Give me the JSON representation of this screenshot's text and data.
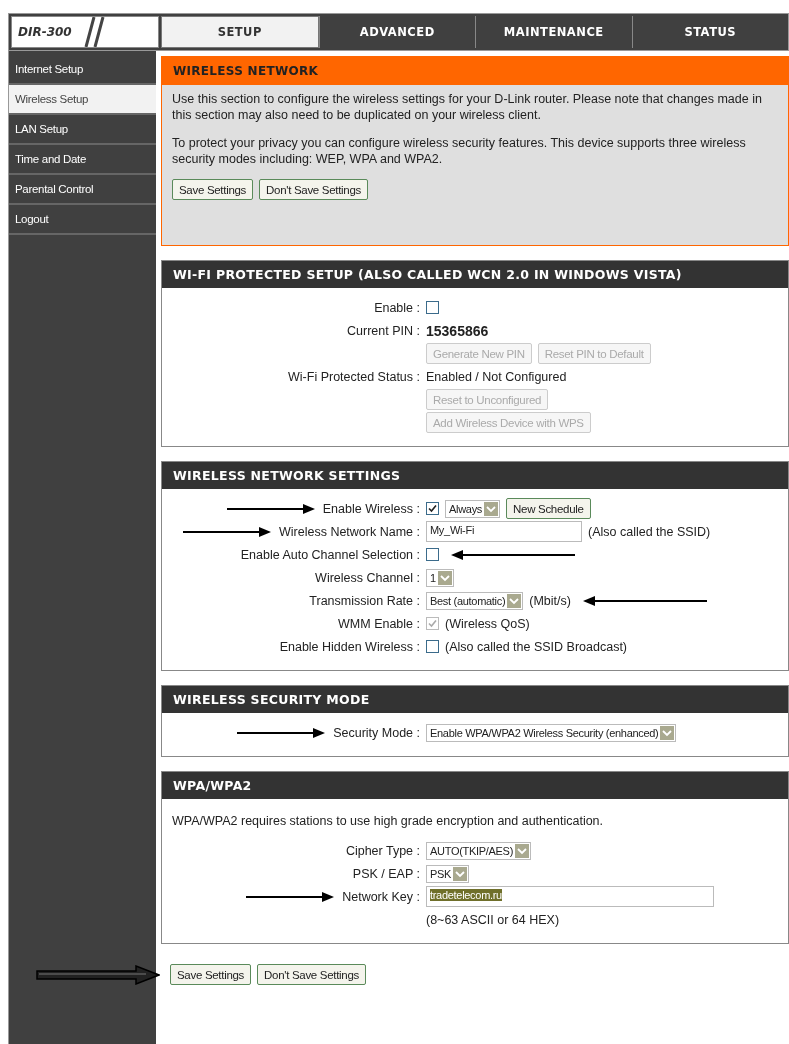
{
  "model": "DIR-300",
  "tabs": [
    {
      "label": "SETUP",
      "selected": true
    },
    {
      "label": "ADVANCED",
      "selected": false
    },
    {
      "label": "MAINTENANCE",
      "selected": false
    },
    {
      "label": "STATUS",
      "selected": false
    }
  ],
  "sidebar": {
    "items": [
      {
        "label": "Internet Setup",
        "selected": false
      },
      {
        "label": "Wireless Setup",
        "selected": true
      },
      {
        "label": "LAN Setup",
        "selected": false
      },
      {
        "label": "Time and Date",
        "selected": false
      },
      {
        "label": "Parental Control",
        "selected": false
      },
      {
        "label": "Logout",
        "selected": false
      }
    ]
  },
  "sections": [
    {
      "kind": "intro",
      "title": "WIRELESS NETWORK",
      "paragraphs": [
        "Use this section to configure the wireless settings for your D-Link router. Please note that changes made in this section may also need to be duplicated on your wireless client.",
        "To protect your privacy you can configure wireless security features. This device supports three wireless security modes including: WEP, WPA and WPA2."
      ],
      "buttons": [
        {
          "label": "Save Settings",
          "disabled": false
        },
        {
          "label": "Don't Save Settings",
          "disabled": false
        }
      ]
    },
    {
      "kind": "panel",
      "title": "WI-FI PROTECTED SETUP (ALSO CALLED WCN 2.0 IN WINDOWS VISTA)",
      "rows": [
        {
          "label": "Enable :",
          "controls": [
            {
              "kind": "checkbox",
              "checked": false,
              "disabled": false
            }
          ]
        },
        {
          "label": "Current PIN :",
          "controls": [
            {
              "kind": "text",
              "text": "15365866",
              "bold": true
            }
          ]
        },
        {
          "controls": [
            {
              "kind": "button",
              "label": "Generate New PIN",
              "disabled": true
            },
            {
              "kind": "button",
              "label": "Reset PIN to Default",
              "disabled": true
            }
          ]
        },
        {
          "label": "Wi-Fi Protected Status :",
          "controls": [
            {
              "kind": "text",
              "text": "Enabled / Not Configured",
              "bold": false
            }
          ]
        },
        {
          "controls": [
            {
              "kind": "button",
              "label": "Reset to Unconfigured",
              "disabled": true
            }
          ]
        },
        {
          "controls": [
            {
              "kind": "button",
              "label": "Add Wireless Device with WPS",
              "disabled": true
            }
          ]
        }
      ]
    },
    {
      "kind": "panel",
      "title": "WIRELESS NETWORK SETTINGS",
      "rows": [
        {
          "label": "Enable Wireless :",
          "arrow_left": true,
          "controls": [
            {
              "kind": "checkbox",
              "checked": true,
              "disabled": false
            },
            {
              "kind": "select",
              "value": "Always"
            },
            {
              "kind": "button",
              "label": "New Schedule",
              "disabled": false
            }
          ]
        },
        {
          "label": "Wireless Network Name :",
          "arrow_left": true,
          "controls": [
            {
              "kind": "input",
              "value": "My_Wi-Fi",
              "highlighted": false
            },
            {
              "kind": "note",
              "text": "(Also called the SSID)"
            }
          ]
        },
        {
          "label": "Enable Auto Channel Selection :",
          "arrow_right": true,
          "controls": [
            {
              "kind": "checkbox",
              "checked": false,
              "disabled": false
            }
          ]
        },
        {
          "label": "Wireless Channel :",
          "controls": [
            {
              "kind": "select",
              "value": "1"
            }
          ]
        },
        {
          "label": "Transmission Rate :",
          "arrow_right": true,
          "controls": [
            {
              "kind": "select",
              "value": "Best (automatic)"
            },
            {
              "kind": "note",
              "text": "(Mbit/s)"
            }
          ]
        },
        {
          "label": "WMM Enable :",
          "controls": [
            {
              "kind": "checkbox",
              "checked": true,
              "disabled": true
            },
            {
              "kind": "note",
              "text": "(Wireless QoS)"
            }
          ]
        },
        {
          "label": "Enable Hidden Wireless :",
          "controls": [
            {
              "kind": "checkbox",
              "checked": false,
              "disabled": false
            },
            {
              "kind": "note",
              "text": "(Also called the SSID Broadcast)"
            }
          ]
        }
      ]
    },
    {
      "kind": "panel",
      "title": "WIRELESS SECURITY MODE",
      "rows": [
        {
          "label": "Security Mode :",
          "arrow_left": true,
          "controls": [
            {
              "kind": "select",
              "value": "Enable WPA/WPA2 Wireless Security (enhanced)"
            }
          ]
        }
      ]
    },
    {
      "kind": "panel",
      "title": "WPA/WPA2",
      "paragraphs": [
        "WPA/WPA2 requires stations to use high grade encryption and authentication."
      ],
      "rows": [
        {
          "label": "Cipher Type :",
          "controls": [
            {
              "kind": "select",
              "value": "AUTO(TKIP/AES)"
            }
          ]
        },
        {
          "label": "PSK / EAP :",
          "controls": [
            {
              "kind": "select",
              "value": "PSK"
            }
          ]
        },
        {
          "label": "Network Key :",
          "arrow_left": true,
          "controls": [
            {
              "kind": "input",
              "value": "tradetelecom.ru",
              "highlighted": true
            }
          ]
        },
        {
          "controls": [
            {
              "kind": "note",
              "text": "(8~63 ASCII or 64 HEX)"
            }
          ]
        }
      ]
    }
  ],
  "footer": {
    "arrow": true,
    "buttons": [
      {
        "label": "Save Settings",
        "disabled": false
      },
      {
        "label": "Don't Save Settings",
        "disabled": false
      }
    ]
  }
}
